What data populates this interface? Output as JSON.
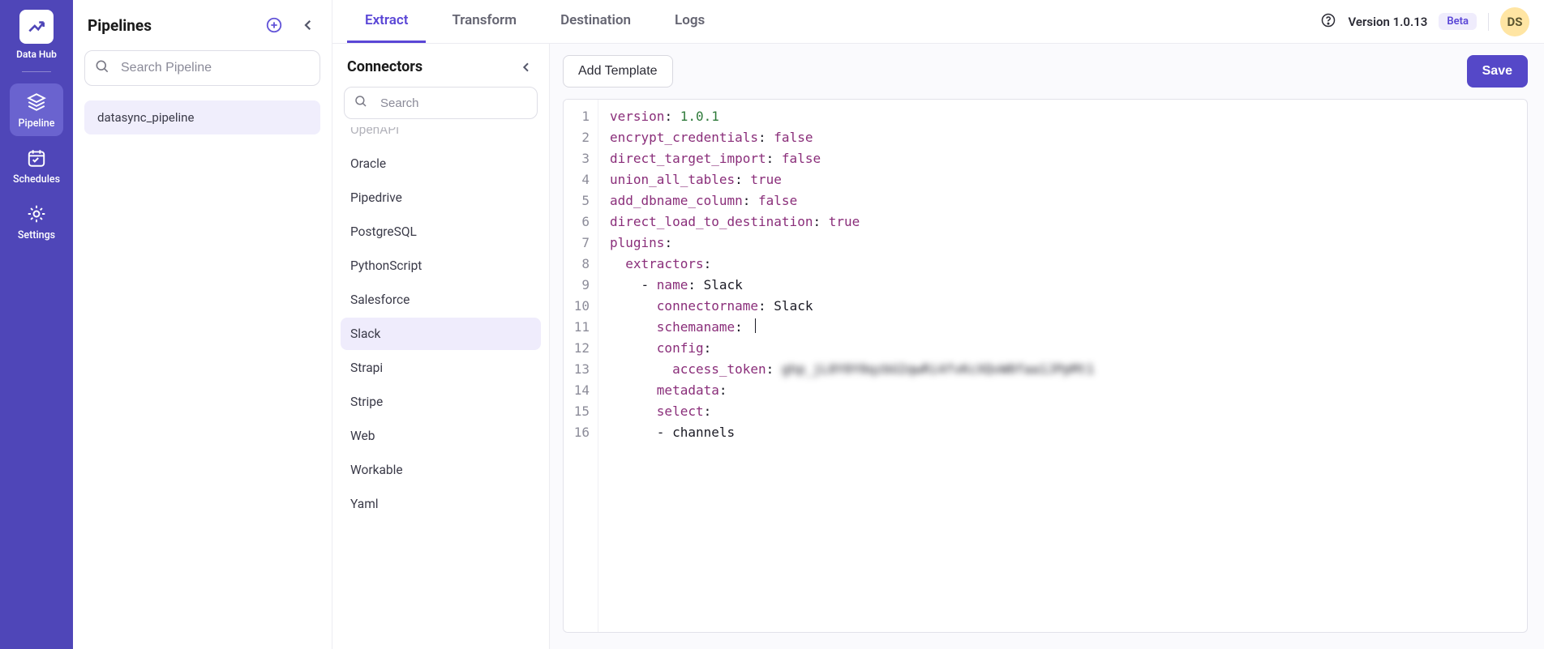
{
  "app": {
    "title": "Data Hub",
    "avatar_initials": "DS",
    "version_label": "Version 1.0.13",
    "beta_label": "Beta"
  },
  "nav": {
    "items": [
      {
        "id": "pipeline",
        "label": "Pipeline",
        "active": true
      },
      {
        "id": "schedules",
        "label": "Schedules",
        "active": false
      },
      {
        "id": "settings",
        "label": "Settings",
        "active": false
      }
    ]
  },
  "pipelines": {
    "title": "Pipelines",
    "search_placeholder": "Search Pipeline",
    "items": [
      {
        "name": "datasync_pipeline",
        "selected": true
      }
    ]
  },
  "tabs": [
    {
      "label": "Extract",
      "active": true
    },
    {
      "label": "Transform",
      "active": false
    },
    {
      "label": "Destination",
      "active": false
    },
    {
      "label": "Logs",
      "active": false
    }
  ],
  "connectors": {
    "title": "Connectors",
    "search_placeholder": "Search",
    "items": [
      {
        "name": "OpenAPI",
        "cutoff": true
      },
      {
        "name": "Oracle"
      },
      {
        "name": "Pipedrive"
      },
      {
        "name": "PostgreSQL"
      },
      {
        "name": "PythonScript"
      },
      {
        "name": "Salesforce"
      },
      {
        "name": "Slack",
        "selected": true
      },
      {
        "name": "Strapi"
      },
      {
        "name": "Stripe"
      },
      {
        "name": "Web"
      },
      {
        "name": "Workable"
      },
      {
        "name": "Yaml"
      }
    ]
  },
  "editor": {
    "add_template_label": "Add Template",
    "save_label": "Save",
    "yaml": {
      "version": "1.0.1",
      "encrypt_credentials": "false",
      "direct_target_import": "false",
      "union_all_tables": "true",
      "add_dbname_column": "false",
      "direct_load_to_destination": "true",
      "extractor_name": "Slack",
      "connectorname": "Slack",
      "schemaname": "",
      "access_token": "ghp_jL0Y0Y0qzbU2qwRi4fvKcXQvW0faa1JPpMt1",
      "select_item": "channels"
    },
    "line_count": 16
  }
}
